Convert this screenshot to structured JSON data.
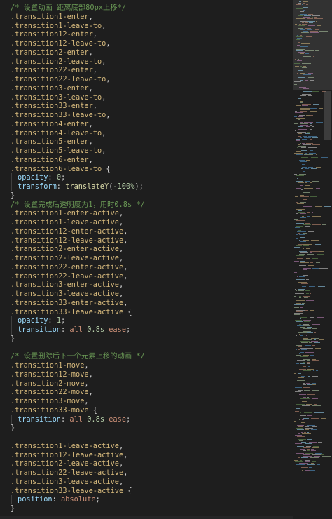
{
  "editor": {
    "lines": [
      {
        "tokens": [
          {
            "t": "/* 设置动画 距离底部80px上移*/",
            "c": "c-comment"
          }
        ]
      },
      {
        "tokens": [
          {
            "t": ".transition1-enter",
            "c": "c-sel"
          },
          {
            "t": ",",
            "c": "c-punc"
          }
        ]
      },
      {
        "tokens": [
          {
            "t": ".transition1-leave-to",
            "c": "c-sel"
          },
          {
            "t": ",",
            "c": "c-punc"
          }
        ]
      },
      {
        "tokens": [
          {
            "t": ".transition12-enter",
            "c": "c-sel"
          },
          {
            "t": ",",
            "c": "c-punc"
          }
        ]
      },
      {
        "tokens": [
          {
            "t": ".transition12-leave-to",
            "c": "c-sel"
          },
          {
            "t": ",",
            "c": "c-punc"
          }
        ]
      },
      {
        "tokens": [
          {
            "t": ".transition2-enter",
            "c": "c-sel"
          },
          {
            "t": ",",
            "c": "c-punc"
          }
        ]
      },
      {
        "tokens": [
          {
            "t": ".transition2-leave-to",
            "c": "c-sel"
          },
          {
            "t": ",",
            "c": "c-punc"
          }
        ]
      },
      {
        "tokens": [
          {
            "t": ".transition22-enter",
            "c": "c-sel"
          },
          {
            "t": ",",
            "c": "c-punc"
          }
        ]
      },
      {
        "tokens": [
          {
            "t": ".transition22-leave-to",
            "c": "c-sel"
          },
          {
            "t": ",",
            "c": "c-punc"
          }
        ]
      },
      {
        "tokens": [
          {
            "t": ".transition3-enter",
            "c": "c-sel"
          },
          {
            "t": ",",
            "c": "c-punc"
          }
        ]
      },
      {
        "tokens": [
          {
            "t": ".transition3-leave-to",
            "c": "c-sel"
          },
          {
            "t": ",",
            "c": "c-punc"
          }
        ]
      },
      {
        "tokens": [
          {
            "t": ".transition33-enter",
            "c": "c-sel"
          },
          {
            "t": ",",
            "c": "c-punc"
          }
        ]
      },
      {
        "tokens": [
          {
            "t": ".transition33-leave-to",
            "c": "c-sel"
          },
          {
            "t": ",",
            "c": "c-punc"
          }
        ]
      },
      {
        "tokens": [
          {
            "t": ".transition4-enter",
            "c": "c-sel"
          },
          {
            "t": ",",
            "c": "c-punc"
          }
        ]
      },
      {
        "tokens": [
          {
            "t": ".transition4-leave-to",
            "c": "c-sel"
          },
          {
            "t": ",",
            "c": "c-punc"
          }
        ]
      },
      {
        "tokens": [
          {
            "t": ".transition5-enter",
            "c": "c-sel"
          },
          {
            "t": ",",
            "c": "c-punc"
          }
        ]
      },
      {
        "tokens": [
          {
            "t": ".transition5-leave-to",
            "c": "c-sel"
          },
          {
            "t": ",",
            "c": "c-punc"
          }
        ]
      },
      {
        "tokens": [
          {
            "t": ".transition6-enter",
            "c": "c-sel"
          },
          {
            "t": ",",
            "c": "c-punc"
          }
        ]
      },
      {
        "tokens": [
          {
            "t": ".transition6-leave-to",
            "c": "c-sel"
          },
          {
            "t": " {",
            "c": "c-punc"
          }
        ]
      },
      {
        "indent": true,
        "tokens": [
          {
            "t": "opacity",
            "c": "c-prop"
          },
          {
            "t": ": ",
            "c": "c-punc"
          },
          {
            "t": "0",
            "c": "c-num"
          },
          {
            "t": ";",
            "c": "c-punc"
          }
        ]
      },
      {
        "indent": true,
        "tokens": [
          {
            "t": "transform",
            "c": "c-prop"
          },
          {
            "t": ": ",
            "c": "c-punc"
          },
          {
            "t": "translateY",
            "c": "c-fn"
          },
          {
            "t": "(",
            "c": "c-punc"
          },
          {
            "t": "-100%",
            "c": "c-num"
          },
          {
            "t": ");",
            "c": "c-punc"
          }
        ]
      },
      {
        "tokens": [
          {
            "t": "}",
            "c": "c-punc"
          }
        ]
      },
      {
        "tokens": [
          {
            "t": "/* 设置完成后透明度为1，用时0.8s */",
            "c": "c-comment"
          }
        ]
      },
      {
        "tokens": [
          {
            "t": ".transition1-enter-active",
            "c": "c-sel"
          },
          {
            "t": ",",
            "c": "c-punc"
          }
        ]
      },
      {
        "tokens": [
          {
            "t": ".transition1-leave-active",
            "c": "c-sel"
          },
          {
            "t": ",",
            "c": "c-punc"
          }
        ]
      },
      {
        "tokens": [
          {
            "t": ".transition12-enter-active",
            "c": "c-sel"
          },
          {
            "t": ",",
            "c": "c-punc"
          }
        ]
      },
      {
        "tokens": [
          {
            "t": ".transition12-leave-active",
            "c": "c-sel"
          },
          {
            "t": ",",
            "c": "c-punc"
          }
        ]
      },
      {
        "tokens": [
          {
            "t": ".transition2-enter-active",
            "c": "c-sel"
          },
          {
            "t": ",",
            "c": "c-punc"
          }
        ]
      },
      {
        "tokens": [
          {
            "t": ".transition2-leave-active",
            "c": "c-sel"
          },
          {
            "t": ",",
            "c": "c-punc"
          }
        ]
      },
      {
        "tokens": [
          {
            "t": ".transition22-enter-active",
            "c": "c-sel"
          },
          {
            "t": ",",
            "c": "c-punc"
          }
        ]
      },
      {
        "tokens": [
          {
            "t": ".transition22-leave-active",
            "c": "c-sel"
          },
          {
            "t": ",",
            "c": "c-punc"
          }
        ]
      },
      {
        "tokens": [
          {
            "t": ".transition3-enter-active",
            "c": "c-sel"
          },
          {
            "t": ",",
            "c": "c-punc"
          }
        ]
      },
      {
        "tokens": [
          {
            "t": ".transition3-leave-active",
            "c": "c-sel"
          },
          {
            "t": ",",
            "c": "c-punc"
          }
        ]
      },
      {
        "tokens": [
          {
            "t": ".transition33-enter-active",
            "c": "c-sel"
          },
          {
            "t": ",",
            "c": "c-punc"
          }
        ]
      },
      {
        "tokens": [
          {
            "t": ".transition33-leave-active",
            "c": "c-sel"
          },
          {
            "t": " {",
            "c": "c-punc"
          }
        ]
      },
      {
        "indent": true,
        "tokens": [
          {
            "t": "opacity",
            "c": "c-prop"
          },
          {
            "t": ": ",
            "c": "c-punc"
          },
          {
            "t": "1",
            "c": "c-num"
          },
          {
            "t": ";",
            "c": "c-punc"
          }
        ]
      },
      {
        "indent": true,
        "tokens": [
          {
            "t": "transition",
            "c": "c-prop"
          },
          {
            "t": ": ",
            "c": "c-punc"
          },
          {
            "t": "all ",
            "c": "c-val"
          },
          {
            "t": "0.8s",
            "c": "c-num"
          },
          {
            "t": " ease",
            "c": "c-val"
          },
          {
            "t": ";",
            "c": "c-punc"
          }
        ]
      },
      {
        "tokens": [
          {
            "t": "}",
            "c": "c-punc"
          }
        ]
      },
      {
        "tokens": []
      },
      {
        "tokens": [
          {
            "t": "/* 设置删除后下一个元素上移的动画 */",
            "c": "c-comment"
          }
        ]
      },
      {
        "tokens": [
          {
            "t": ".transition1-move",
            "c": "c-sel"
          },
          {
            "t": ",",
            "c": "c-punc"
          }
        ]
      },
      {
        "tokens": [
          {
            "t": ".transition12-move",
            "c": "c-sel"
          },
          {
            "t": ",",
            "c": "c-punc"
          }
        ]
      },
      {
        "tokens": [
          {
            "t": ".transition2-move",
            "c": "c-sel"
          },
          {
            "t": ",",
            "c": "c-punc"
          }
        ]
      },
      {
        "tokens": [
          {
            "t": ".transition22-move",
            "c": "c-sel"
          },
          {
            "t": ",",
            "c": "c-punc"
          }
        ]
      },
      {
        "tokens": [
          {
            "t": ".transition3-move",
            "c": "c-sel"
          },
          {
            "t": ",",
            "c": "c-punc"
          }
        ]
      },
      {
        "tokens": [
          {
            "t": ".transition33-move",
            "c": "c-sel"
          },
          {
            "t": " {",
            "c": "c-punc"
          }
        ]
      },
      {
        "indent": true,
        "tokens": [
          {
            "t": "transition",
            "c": "c-prop"
          },
          {
            "t": ": ",
            "c": "c-punc"
          },
          {
            "t": "all ",
            "c": "c-val"
          },
          {
            "t": "0.8s",
            "c": "c-num"
          },
          {
            "t": " ease",
            "c": "c-val"
          },
          {
            "t": ";",
            "c": "c-punc"
          }
        ]
      },
      {
        "tokens": [
          {
            "t": "}",
            "c": "c-punc"
          }
        ]
      },
      {
        "tokens": []
      },
      {
        "tokens": [
          {
            "t": ".transition1-leave-active",
            "c": "c-sel"
          },
          {
            "t": ",",
            "c": "c-punc"
          }
        ]
      },
      {
        "tokens": [
          {
            "t": ".transition12-leave-active",
            "c": "c-sel"
          },
          {
            "t": ",",
            "c": "c-punc"
          }
        ]
      },
      {
        "tokens": [
          {
            "t": ".transition2-leave-active",
            "c": "c-sel"
          },
          {
            "t": ",",
            "c": "c-punc"
          }
        ]
      },
      {
        "tokens": [
          {
            "t": ".transition22-leave-active",
            "c": "c-sel"
          },
          {
            "t": ",",
            "c": "c-punc"
          }
        ]
      },
      {
        "tokens": [
          {
            "t": ".transition3-leave-active",
            "c": "c-sel"
          },
          {
            "t": ",",
            "c": "c-punc"
          }
        ]
      },
      {
        "tokens": [
          {
            "t": ".transition33-leave-active",
            "c": "c-sel"
          },
          {
            "t": " {",
            "c": "c-punc"
          }
        ]
      },
      {
        "indent": true,
        "tokens": [
          {
            "t": "position",
            "c": "c-prop"
          },
          {
            "t": ": ",
            "c": "c-punc"
          },
          {
            "t": "absolute",
            "c": "c-val"
          },
          {
            "t": ";",
            "c": "c-punc"
          }
        ]
      },
      {
        "tokens": [
          {
            "t": "}",
            "c": "c-punc"
          }
        ]
      }
    ]
  },
  "colors": {
    "background": "#1e1e1e",
    "comment": "#6a9955",
    "selector": "#d7ba7d",
    "property": "#9cdcfe",
    "number": "#b5cea8",
    "string_value": "#ce9178",
    "function": "#dcdcaa",
    "punctuation": "#d4d4d4"
  }
}
